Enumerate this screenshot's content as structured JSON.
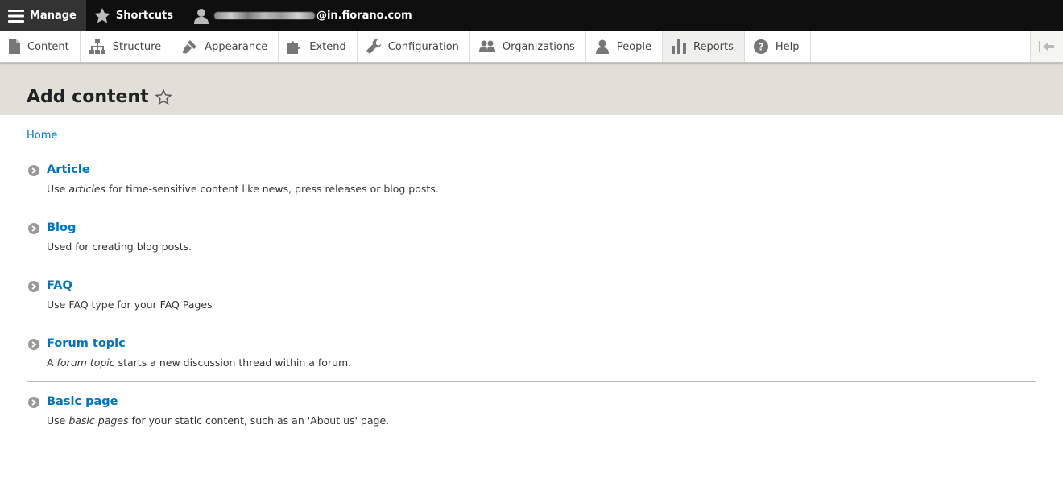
{
  "toolbar": {
    "manage_label": "Manage",
    "shortcuts_label": "Shortcuts",
    "user_domain": "@in.fiorano.com"
  },
  "tray": {
    "items": [
      {
        "label": "Content",
        "icon": "file-icon"
      },
      {
        "label": "Structure",
        "icon": "sitemap-icon"
      },
      {
        "label": "Appearance",
        "icon": "paintbrush-icon"
      },
      {
        "label": "Extend",
        "icon": "puzzle-icon"
      },
      {
        "label": "Configuration",
        "icon": "wrench-icon"
      },
      {
        "label": "Organizations",
        "icon": "group-icon"
      },
      {
        "label": "People",
        "icon": "person-icon"
      },
      {
        "label": "Reports",
        "icon": "bar-chart-icon"
      },
      {
        "label": "Help",
        "icon": "help-icon"
      }
    ]
  },
  "page": {
    "title": "Add content",
    "breadcrumb": "Home"
  },
  "content_types": [
    {
      "title": "Article",
      "desc_pre": "Use ",
      "desc_em": "articles",
      "desc_post": " for time-sensitive content like news, press releases or blog posts."
    },
    {
      "title": "Blog",
      "desc_pre": "Used for creating blog posts.",
      "desc_em": "",
      "desc_post": ""
    },
    {
      "title": "FAQ",
      "desc_pre": "Use FAQ type for your FAQ Pages",
      "desc_em": "",
      "desc_post": ""
    },
    {
      "title": "Forum topic",
      "desc_pre": "A ",
      "desc_em": "forum topic",
      "desc_post": " starts a new discussion thread within a forum."
    },
    {
      "title": "Basic page",
      "desc_pre": "Use ",
      "desc_em": "basic pages",
      "desc_post": " for your static content, such as an 'About us' page."
    }
  ],
  "colors": {
    "link": "#0074bd",
    "toolbar_bg": "#0f0f0f",
    "header_bg": "#e0e0d8"
  }
}
